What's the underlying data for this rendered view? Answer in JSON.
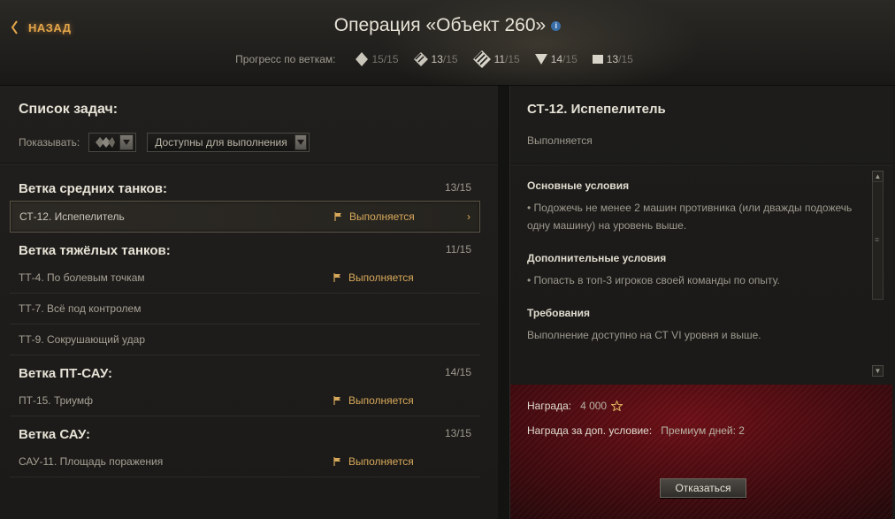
{
  "header": {
    "back_label": "НАЗАД",
    "title": "Операция «Объект 260»",
    "info_icon": "i",
    "progress_label": "Прогресс по веткам:",
    "branches": [
      {
        "icon": "medium-tank-icon",
        "done": "15",
        "total": "/15"
      },
      {
        "icon": "heavy-tank-icon",
        "done": "13",
        "total": "/15"
      },
      {
        "icon": "light-tank-icon",
        "done": "11",
        "total": "/15"
      },
      {
        "icon": "td-icon",
        "done": "14",
        "total": "/15"
      },
      {
        "icon": "spg-icon",
        "done": "13",
        "total": "/15"
      }
    ]
  },
  "left": {
    "title": "Список задач:",
    "show_label": "Показывать:",
    "filter_value": "Доступны для выполнения",
    "groups": [
      {
        "title": "Ветка средних танков:",
        "count": "13/15",
        "tasks": [
          {
            "name": "СТ-12. Испепелитель",
            "status": "Выполняется",
            "chevron": "›"
          }
        ]
      },
      {
        "title": "Ветка тяжёлых танков:",
        "count": "11/15",
        "tasks": [
          {
            "name": "ТТ-4. По болевым точкам",
            "status": "Выполняется"
          },
          {
            "name": "ТТ-7. Всё под контролем",
            "status": ""
          },
          {
            "name": "ТТ-9. Сокрушающий удар",
            "status": ""
          }
        ]
      },
      {
        "title": "Ветка ПТ-САУ:",
        "count": "14/15",
        "tasks": [
          {
            "name": "ПТ-15. Триумф",
            "status": "Выполняется"
          }
        ]
      },
      {
        "title": "Ветка САУ:",
        "count": "13/15",
        "tasks": [
          {
            "name": "САУ-11. Площадь поражения",
            "status": "Выполняется"
          }
        ]
      }
    ]
  },
  "right": {
    "title": "СТ-12. Испепелитель",
    "status": "Выполняется",
    "conditions": [
      {
        "head": "Основные условия",
        "text": "• Подожечь не менее 2 машин противника (или дважды подожечь одну машину) на уровень выше."
      },
      {
        "head": "Дополнительные условия",
        "text": "• Попасть в топ-3 игроков своей команды по опыту."
      },
      {
        "head": "Требования",
        "text": "Выполнение доступно на СТ VI уровня и выше."
      }
    ],
    "scroll_up": "▲",
    "scroll_down": "▼",
    "reward_label": "Награда:",
    "reward_value": "4 000",
    "bonus_label": "Награда за доп. условие:",
    "bonus_value": "Премиум дней: 2",
    "refuse_label": "Отказаться"
  },
  "colors": {
    "accent": "#e3a64a",
    "status": "#d7a85a",
    "reward_bg": "#6e1017"
  }
}
